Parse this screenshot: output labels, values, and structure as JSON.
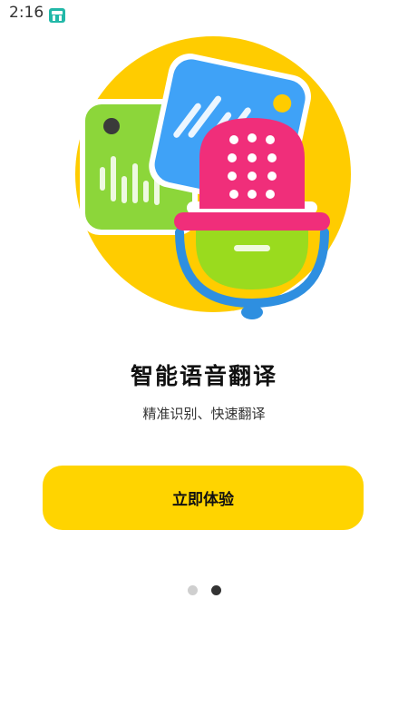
{
  "status_bar": {
    "time": "2:16",
    "app_icon": "ghost-app-icon"
  },
  "hero": {
    "icon": "voice-translate-illustration",
    "colors": {
      "circle": "#FFCC00",
      "green_card": "#8CD63A",
      "blue_card": "#3FA2F7",
      "mic_head": "#F02E7A",
      "mic_body": "#9ADB1E",
      "stand": "#2E8FE0"
    }
  },
  "title": "智能语音翻译",
  "subtitle": "精准识别、快速翻译",
  "cta": {
    "label": "立即体验",
    "color": "#FFD400"
  },
  "pager": {
    "count": 2,
    "active_index": 1
  }
}
